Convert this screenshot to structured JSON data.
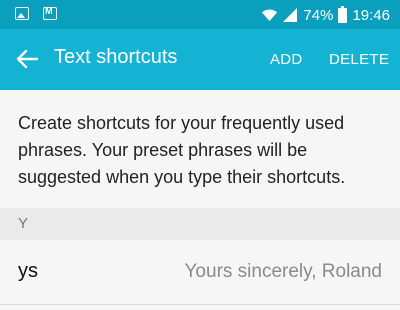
{
  "status_bar": {
    "battery_percent": "74%",
    "time": "19:46",
    "left_icons": [
      "image-notification-icon",
      "mail-notification-icon"
    ],
    "right_icons": [
      "wifi-icon",
      "signal-icon",
      "battery-icon"
    ]
  },
  "app_bar": {
    "title": "Text shortcuts",
    "add_label": "ADD",
    "delete_label": "DELETE",
    "back_icon": "back-arrow-icon"
  },
  "description": "Create shortcuts for your frequently used phrases. Your preset phrases will be suggested when you type their shortcuts.",
  "sections": [
    {
      "header": "Y",
      "items": [
        {
          "shortcut": "ys",
          "phrase": "Yours sincerely, Roland"
        }
      ]
    }
  ],
  "colors": {
    "status_bar": "#0b9fbe",
    "app_bar": "#15b3d3",
    "background": "#f6f6f6",
    "section_header_bg": "#eaeaea"
  }
}
